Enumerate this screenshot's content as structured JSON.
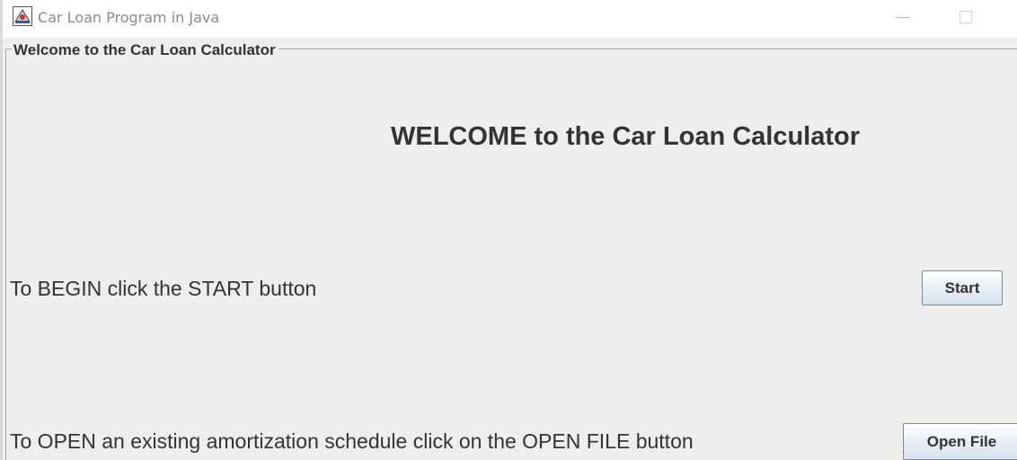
{
  "window": {
    "title": "Car Loan Program in Java",
    "icon": "java-app-icon",
    "controls": [
      "minimize",
      "maximize"
    ]
  },
  "panel": {
    "legend": "Welcome to the Car Loan Calculator",
    "heading": "WELCOME to the Car Loan Calculator"
  },
  "start_section": {
    "instruction": "To BEGIN click the START button",
    "button_label": "Start"
  },
  "open_section": {
    "instruction": "To OPEN an existing amortization schedule click on the OPEN FILE button",
    "button_label": "Open File"
  },
  "colors": {
    "background": "#eeeeee",
    "text": "#333333",
    "title_text": "#8a8a8a",
    "button_border": "#7a8a99"
  }
}
